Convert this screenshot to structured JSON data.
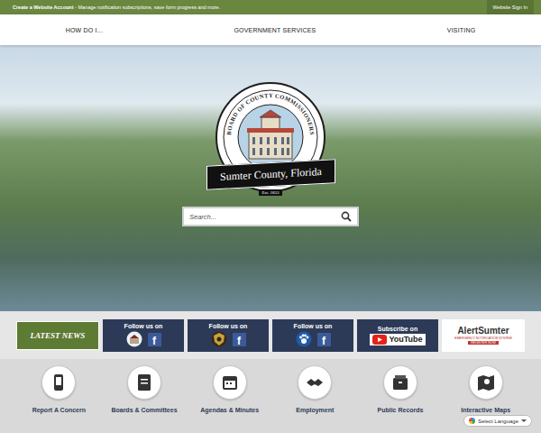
{
  "top_bar": {
    "account_link": "Create a Website Account",
    "message": " - Manage notification subscriptions, save form progress and more.",
    "sign_in": "Website Sign In"
  },
  "nav": [
    "HOW DO I...",
    "GOVERNMENT SERVICES",
    "VISITING"
  ],
  "logo": {
    "arc": "BOARD OF COUNTY COMMISSIONERS",
    "name": "Sumter County, Florida",
    "est": "Est. 1853"
  },
  "search": {
    "placeholder": "Search..."
  },
  "latest_news": "LATEST NEWS",
  "social": [
    {
      "kicker": "Follow us on",
      "kind": "courthouse",
      "badge": "f"
    },
    {
      "kicker": "Follow us on",
      "kind": "sheriff",
      "badge": "f"
    },
    {
      "kicker": "Follow us on",
      "kind": "animal",
      "badge": "f"
    },
    {
      "kicker": "Subscribe on",
      "kind": "youtube",
      "badge": "YouTube"
    }
  ],
  "alert": {
    "name": "AlertSumter",
    "subtitle": "EMERGENCY NOTIFICATION SYSTEM",
    "cta": "REGISTER NOW"
  },
  "quick_links": [
    "Report A Concern",
    "Boards & Committees",
    "Agendas & Minutes",
    "Employment",
    "Public Records",
    "Interactive Maps"
  ],
  "translate": "Select Language"
}
